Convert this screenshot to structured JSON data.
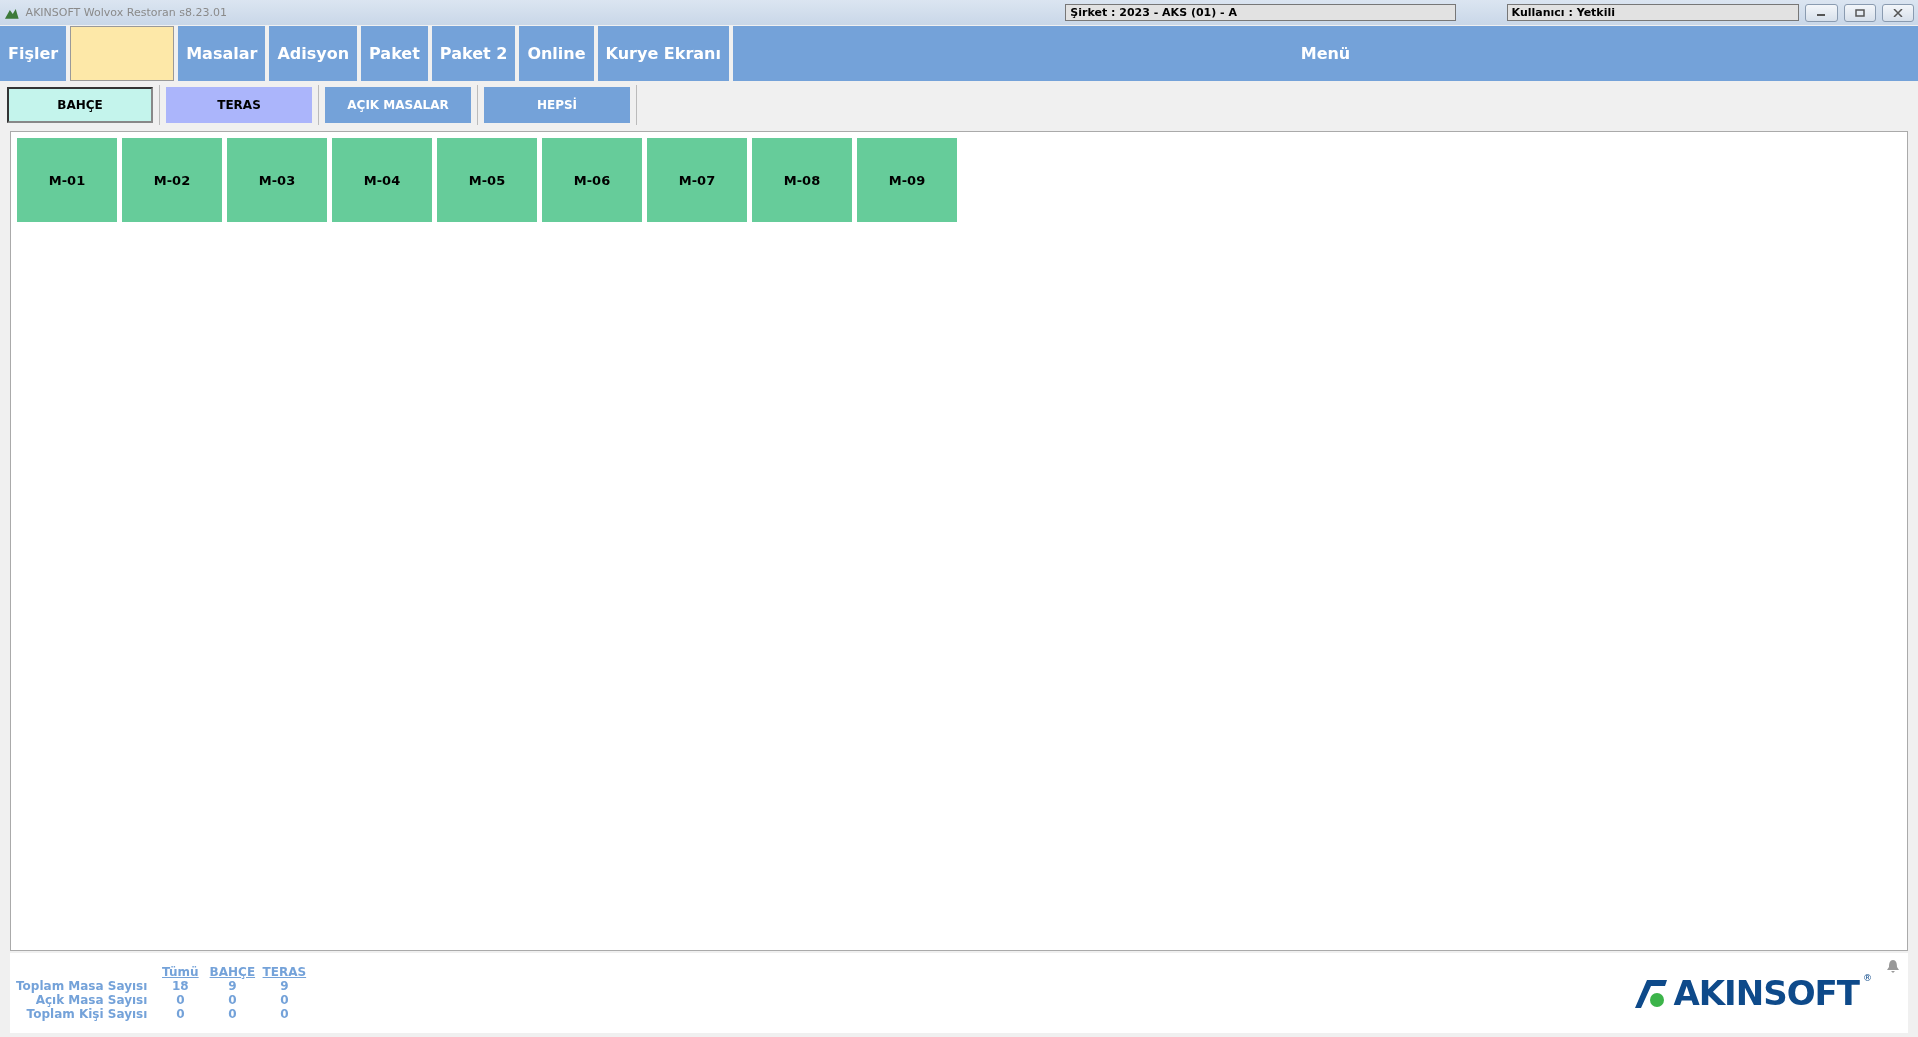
{
  "window": {
    "title": "AKINSOFT Wolvox Restoran s8.23.01",
    "company": "Şirket : 2023 - AKS (01) - A",
    "user": "Kullanıcı : Yetkili"
  },
  "menu": [
    {
      "kind": "button",
      "label": "Fişler"
    },
    {
      "kind": "blank"
    },
    {
      "kind": "button",
      "label": "Masalar"
    },
    {
      "kind": "button",
      "label": "Adisyon"
    },
    {
      "kind": "button",
      "label": "Paket"
    },
    {
      "kind": "button",
      "label": "Paket 2"
    },
    {
      "kind": "button",
      "label": "Online"
    },
    {
      "kind": "button",
      "label": "Kurye Ekranı"
    },
    {
      "kind": "wide",
      "label": "Menü"
    }
  ],
  "areas": [
    {
      "label": "BAHÇE",
      "color": "#c4f4ec",
      "selected": true
    },
    {
      "label": "TERAS",
      "color": "#abb5fb",
      "selected": false
    },
    {
      "label": "AÇIK MASALAR",
      "color": "#74a2d9",
      "selected": false
    },
    {
      "label": "HEPSİ",
      "color": "#74a2d9",
      "selected": false
    }
  ],
  "tables": [
    {
      "label": "M-01",
      "color": "#66cc9a"
    },
    {
      "label": "M-02",
      "color": "#66cc9a"
    },
    {
      "label": "M-03",
      "color": "#66cc9a"
    },
    {
      "label": "M-04",
      "color": "#66cc9a"
    },
    {
      "label": "M-05",
      "color": "#66cc9a"
    },
    {
      "label": "M-06",
      "color": "#66cc9a"
    },
    {
      "label": "M-07",
      "color": "#66cc9a"
    },
    {
      "label": "M-08",
      "color": "#66cc9a"
    },
    {
      "label": "M-09",
      "color": "#66cc9a"
    }
  ],
  "stats": {
    "columns": [
      "Tümü",
      "BAHÇE",
      "TERAS"
    ],
    "rows": [
      {
        "label": "Toplam Masa Sayısı",
        "values": [
          "18",
          "9",
          "9"
        ]
      },
      {
        "label": "Açık Masa Sayısı",
        "values": [
          "0",
          "0",
          "0"
        ]
      },
      {
        "label": "Toplam Kişi Sayısı",
        "values": [
          "0",
          "0",
          "0"
        ]
      }
    ]
  },
  "logo": {
    "text": "AKINSOFT",
    "mark": "®"
  }
}
